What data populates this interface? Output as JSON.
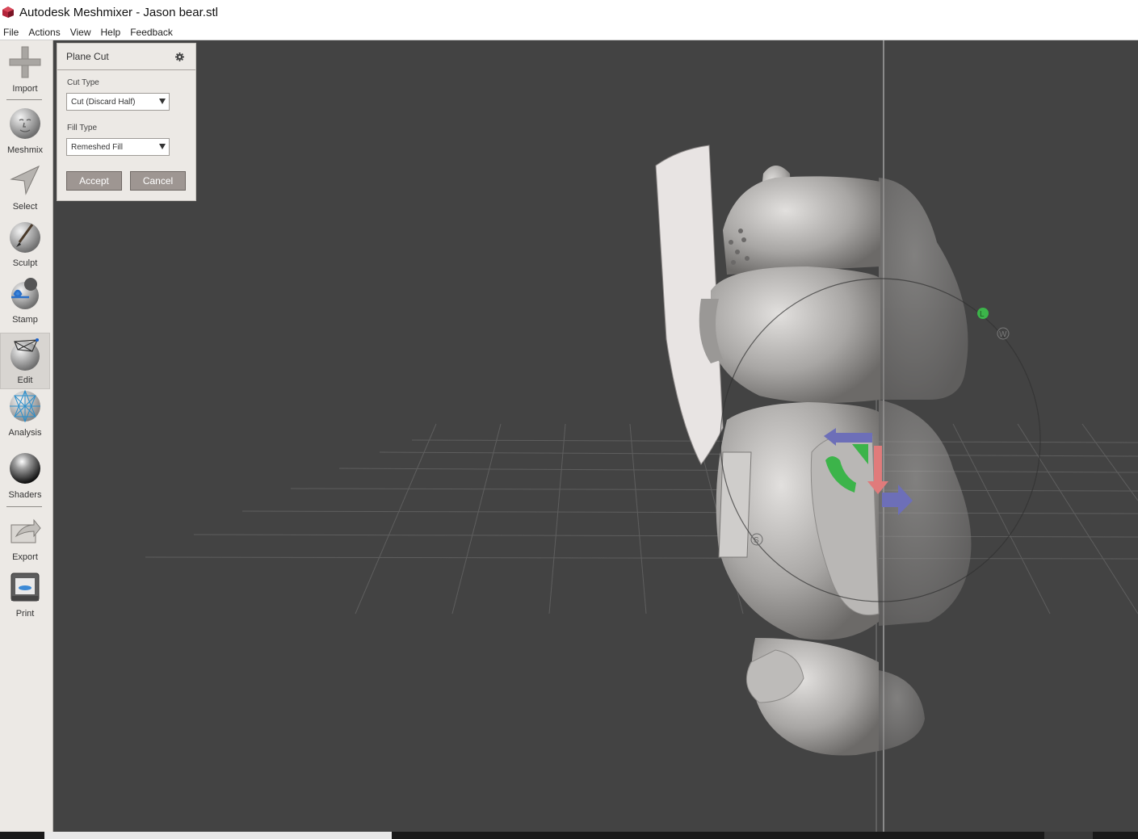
{
  "window": {
    "title": "Autodesk Meshmixer - Jason bear.stl"
  },
  "menu": [
    "File",
    "Actions",
    "View",
    "Help",
    "Feedback"
  ],
  "toolbar": {
    "items": [
      {
        "label": "Import",
        "icon": "plus-icon"
      },
      {
        "label": "Meshmix",
        "icon": "meshmix-face-icon"
      },
      {
        "label": "Select",
        "icon": "select-arrow-icon"
      },
      {
        "label": "Sculpt",
        "icon": "sculpt-brush-icon"
      },
      {
        "label": "Stamp",
        "icon": "stamp-icon"
      },
      {
        "label": "Edit",
        "icon": "edit-wireframe-icon"
      },
      {
        "label": "Analysis",
        "icon": "analysis-sphere-icon"
      },
      {
        "label": "Shaders",
        "icon": "shaders-sphere-icon"
      },
      {
        "label": "Export",
        "icon": "export-icon"
      },
      {
        "label": "Print",
        "icon": "printer-icon"
      }
    ],
    "active": "Edit"
  },
  "panel": {
    "title": "Plane Cut",
    "cut_type_label": "Cut Type",
    "cut_type_value": "Cut (Discard Half)",
    "fill_type_label": "Fill Type",
    "fill_type_value": "Remeshed Fill",
    "accept_label": "Accept",
    "cancel_label": "Cancel"
  },
  "gizmo": {
    "handle_l": "L",
    "handle_w": "W",
    "handle_s": "S"
  },
  "colors": {
    "viewport_bg": "#434343",
    "toolbar_bg": "#ece9e5",
    "button_bg": "#9e9692",
    "gizmo_green": "#3cb44a",
    "gizmo_blue": "#6d6fb8",
    "gizmo_red": "#e07b7b"
  }
}
